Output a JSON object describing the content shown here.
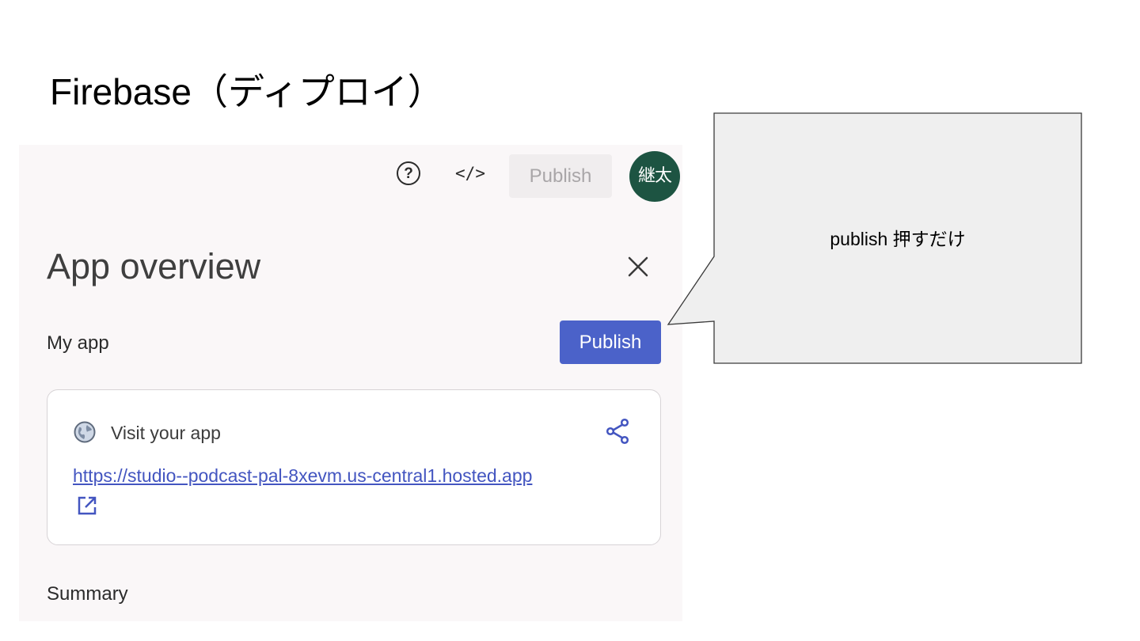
{
  "slide": {
    "title": "Firebase（ディプロイ）"
  },
  "topbar": {
    "help_icon": "help-circle-icon",
    "help_glyph": "?",
    "code_icon": "code-icon",
    "code_glyph": "</>",
    "publish_label": "Publish",
    "avatar_text": "継太",
    "avatar_color": "#1d5442"
  },
  "overview": {
    "title": "App overview",
    "close_icon": "close-icon",
    "app_name": "My app",
    "publish_label": "Publish",
    "accent_color": "#4b62c9"
  },
  "visit_card": {
    "label": "Visit your app",
    "globe_icon": "globe-icon",
    "share_icon": "share-icon",
    "url": "https://studio--podcast-pal-8xevm.us-central1.hosted.app",
    "external_icon": "external-link-icon"
  },
  "summary": {
    "label": "Summary"
  },
  "callout": {
    "text": "publish 押すだけ",
    "fill_color": "#efefef"
  }
}
